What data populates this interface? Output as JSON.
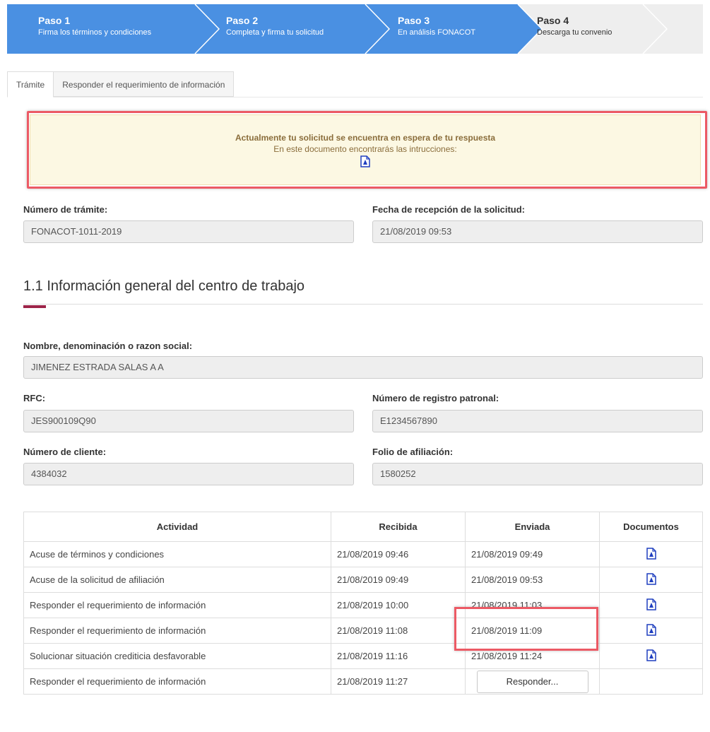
{
  "stepper": {
    "steps": [
      {
        "title": "Paso 1",
        "subtitle": "Firma los términos y condiciones",
        "state": "done"
      },
      {
        "title": "Paso 2",
        "subtitle": "Completa y firma tu solicitud",
        "state": "done"
      },
      {
        "title": "Paso 3",
        "subtitle": "En análisis FONACOT",
        "state": "done"
      },
      {
        "title": "Paso 4",
        "subtitle": "Descarga tu convenio",
        "state": "pending"
      }
    ],
    "colors": {
      "active": "#4a90e2",
      "inactive": "#eeeeee"
    }
  },
  "tabs": [
    {
      "label": "Trámite",
      "active": true
    },
    {
      "label": "Responder el requerimiento de información",
      "active": false
    }
  ],
  "alert": {
    "title": "Actualmente tu solicitud se encuentra en espera de tu respuesta",
    "subtitle": "En este documento encontrarás las intrucciones:",
    "icon": "pdf-document-icon"
  },
  "tramite": {
    "numero_label": "Número de trámite:",
    "numero_value": "FONACOT-1011-2019",
    "fecha_label": "Fecha de recepción de la solicitud:",
    "fecha_value": "21/08/2019 09:53"
  },
  "section": {
    "title": "1.1 Información general del centro de trabajo",
    "accent_color": "#9d2449"
  },
  "centro": {
    "nombre_label": "Nombre, denominación o razon social:",
    "nombre_value": "JIMENEZ ESTRADA SALAS A A",
    "rfc_label": "RFC:",
    "rfc_value": "JES900109Q90",
    "registro_label": "Número de registro patronal:",
    "registro_value": "E1234567890",
    "cliente_label": "Número de cliente:",
    "cliente_value": "4384032",
    "folio_label": "Folio de afiliación:",
    "folio_value": "1580252"
  },
  "table": {
    "headers": [
      "Actividad",
      "Recibida",
      "Enviada",
      "Documentos"
    ],
    "rows": [
      {
        "actividad": "Acuse de términos y condiciones",
        "recibida": "21/08/2019 09:46",
        "enviada": "21/08/2019 09:49",
        "documento": "pdf-document-icon"
      },
      {
        "actividad": "Acuse de la solicitud de afiliación",
        "recibida": "21/08/2019 09:49",
        "enviada": "21/08/2019 09:53",
        "documento": "pdf-document-icon"
      },
      {
        "actividad": "Responder el requerimiento de información",
        "recibida": "21/08/2019 10:00",
        "enviada": "21/08/2019 11:03",
        "documento": "pdf-document-icon"
      },
      {
        "actividad": "Responder el requerimiento de información",
        "recibida": "21/08/2019 11:08",
        "enviada": "21/08/2019 11:09",
        "documento": "pdf-document-icon"
      },
      {
        "actividad": "Solucionar situación crediticia desfavorable",
        "recibida": "21/08/2019 11:16",
        "enviada": "21/08/2019 11:24",
        "documento": "pdf-document-icon"
      },
      {
        "actividad": "Responder el requerimiento de información",
        "recibida": "21/08/2019 11:27",
        "enviada": "",
        "documento": ""
      }
    ],
    "respond_button": "Responder..."
  },
  "highlight_color": "#ec5a65"
}
